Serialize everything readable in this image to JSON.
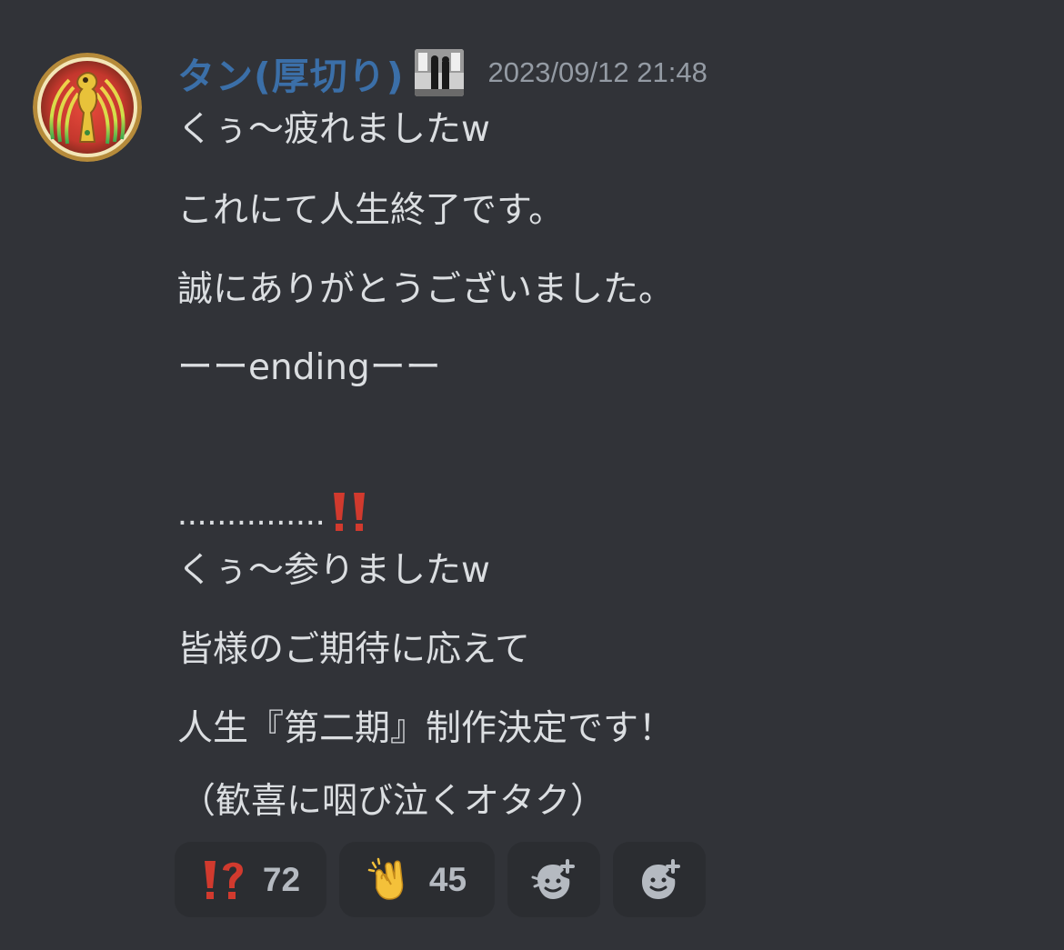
{
  "message": {
    "author": "タン(厚切り)",
    "timestamp": "2023/09/12 21:48",
    "lines": [
      "くぅ〜疲れましたw",
      "これにて人生終了です。",
      "誠にありがとうございました。",
      "ーーendingーー",
      "",
      "...............",
      "くぅ〜参りましたw",
      "皆様のご期待に応えて",
      "人生『第二期』制作決定です！",
      "（歓喜に咽び泣くオタク）"
    ],
    "dots_emoji": "double-exclamation-icon"
  },
  "reactions": [
    {
      "emoji": "interrobang-icon",
      "count": "72"
    },
    {
      "emoji": "clapping-hands-icon",
      "count": "45"
    },
    {
      "emoji": "add-super-reaction-icon",
      "count": ""
    },
    {
      "emoji": "add-reaction-icon",
      "count": ""
    }
  ],
  "colors": {
    "background": "#313338",
    "username": "#3b6fa8",
    "text": "#dbdee1",
    "timestamp": "#949ba4",
    "reaction_bg": "#2b2d31",
    "emoji_red": "#d13a2e"
  }
}
